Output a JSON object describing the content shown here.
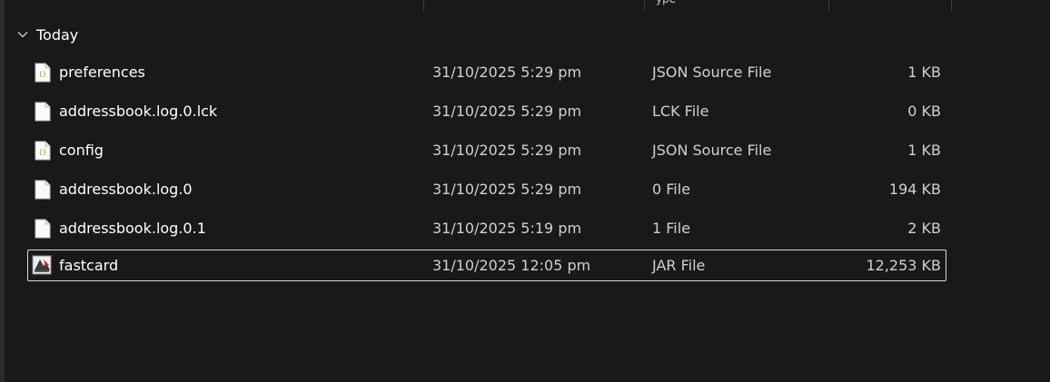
{
  "columns": {
    "type_header_fragment": "ype"
  },
  "group": {
    "label": "Today",
    "icon": "chevron-down-icon"
  },
  "files": [
    {
      "name": "preferences",
      "date": "31/10/2025 5:29 pm",
      "type": "JSON Source File",
      "size": "1 KB",
      "icon": "json-file-icon"
    },
    {
      "name": "addressbook.log.0.lck",
      "date": "31/10/2025 5:29 pm",
      "type": "LCK File",
      "size": "0 KB",
      "icon": "blank-file-icon"
    },
    {
      "name": "config",
      "date": "31/10/2025 5:29 pm",
      "type": "JSON Source File",
      "size": "1 KB",
      "icon": "json-file-icon"
    },
    {
      "name": "addressbook.log.0",
      "date": "31/10/2025 5:29 pm",
      "type": "0 File",
      "size": "194 KB",
      "icon": "blank-file-icon"
    },
    {
      "name": "addressbook.log.0.1",
      "date": "31/10/2025 5:19 pm",
      "type": "1 File",
      "size": "2 KB",
      "icon": "blank-file-icon"
    },
    {
      "name": "fastcard",
      "date": "31/10/2025 12:05 pm",
      "type": "JAR File",
      "size": "12,253 KB",
      "icon": "jar-file-icon",
      "focused": true
    }
  ]
}
